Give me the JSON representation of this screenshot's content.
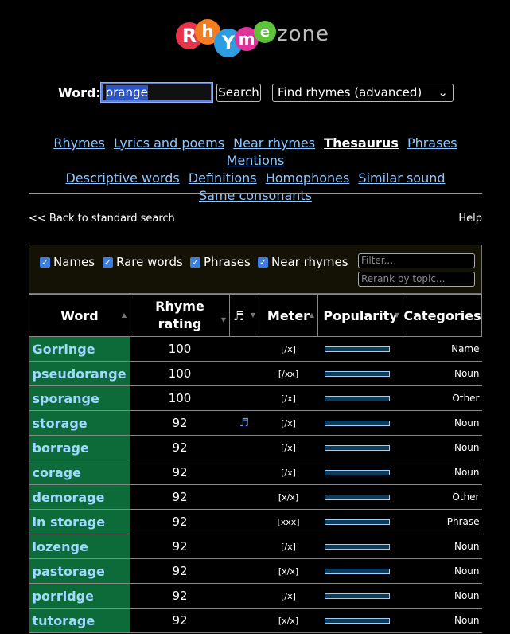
{
  "logo": {
    "rhyme": "RhYme",
    "zone": "zone"
  },
  "search": {
    "label": "Word:",
    "value": "orange",
    "button": "Search",
    "mode": "Find rhymes (advanced)"
  },
  "nav": [
    "Rhymes",
    "Lyrics and poems",
    "Near rhymes",
    "Thesaurus",
    "Phrases",
    "Mentions",
    "Descriptive words",
    "Definitions",
    "Homophones",
    "Similar sound",
    "Same consonants"
  ],
  "nav_active": "Thesaurus",
  "back_link": "<< Back to standard search",
  "help_link": "Help",
  "filters": {
    "checkboxes": [
      {
        "label": "Names",
        "checked": true
      },
      {
        "label": "Rare words",
        "checked": true
      },
      {
        "label": "Phrases",
        "checked": true
      },
      {
        "label": "Near rhymes",
        "checked": true
      }
    ],
    "filter_placeholder": "Filter...",
    "rerank_placeholder": "Rerank by topic..."
  },
  "table": {
    "headers": {
      "word": "Word",
      "rating": "Rhyme rating",
      "music": "♬",
      "meter": "Meter",
      "popularity": "Popularity",
      "categories": "Categories"
    },
    "rows": [
      {
        "word": "Gorringe",
        "rating": "100",
        "music": false,
        "meter": "[/x]",
        "category": "Name"
      },
      {
        "word": "pseudorange",
        "rating": "100",
        "music": false,
        "meter": "[/xx]",
        "category": "Noun"
      },
      {
        "word": "sporange",
        "rating": "100",
        "music": false,
        "meter": "[/x]",
        "category": "Other"
      },
      {
        "word": "storage",
        "rating": "92",
        "music": true,
        "meter": "[/x]",
        "category": "Noun"
      },
      {
        "word": "borrage",
        "rating": "92",
        "music": false,
        "meter": "[/x]",
        "category": "Noun"
      },
      {
        "word": "corage",
        "rating": "92",
        "music": false,
        "meter": "[/x]",
        "category": "Noun"
      },
      {
        "word": "demorage",
        "rating": "92",
        "music": false,
        "meter": "[x/x]",
        "category": "Other"
      },
      {
        "word": "in storage",
        "rating": "92",
        "music": false,
        "meter": "[xxx]",
        "category": "Phrase"
      },
      {
        "word": "lozenge",
        "rating": "92",
        "music": false,
        "meter": "[/x]",
        "category": "Noun"
      },
      {
        "word": "pastorage",
        "rating": "92",
        "music": false,
        "meter": "[x/x]",
        "category": "Noun"
      },
      {
        "word": "porridge",
        "rating": "92",
        "music": false,
        "meter": "[/x]",
        "category": "Noun"
      },
      {
        "word": "tutorage",
        "rating": "92",
        "music": false,
        "meter": "[x/x]",
        "category": "Noun"
      }
    ]
  }
}
